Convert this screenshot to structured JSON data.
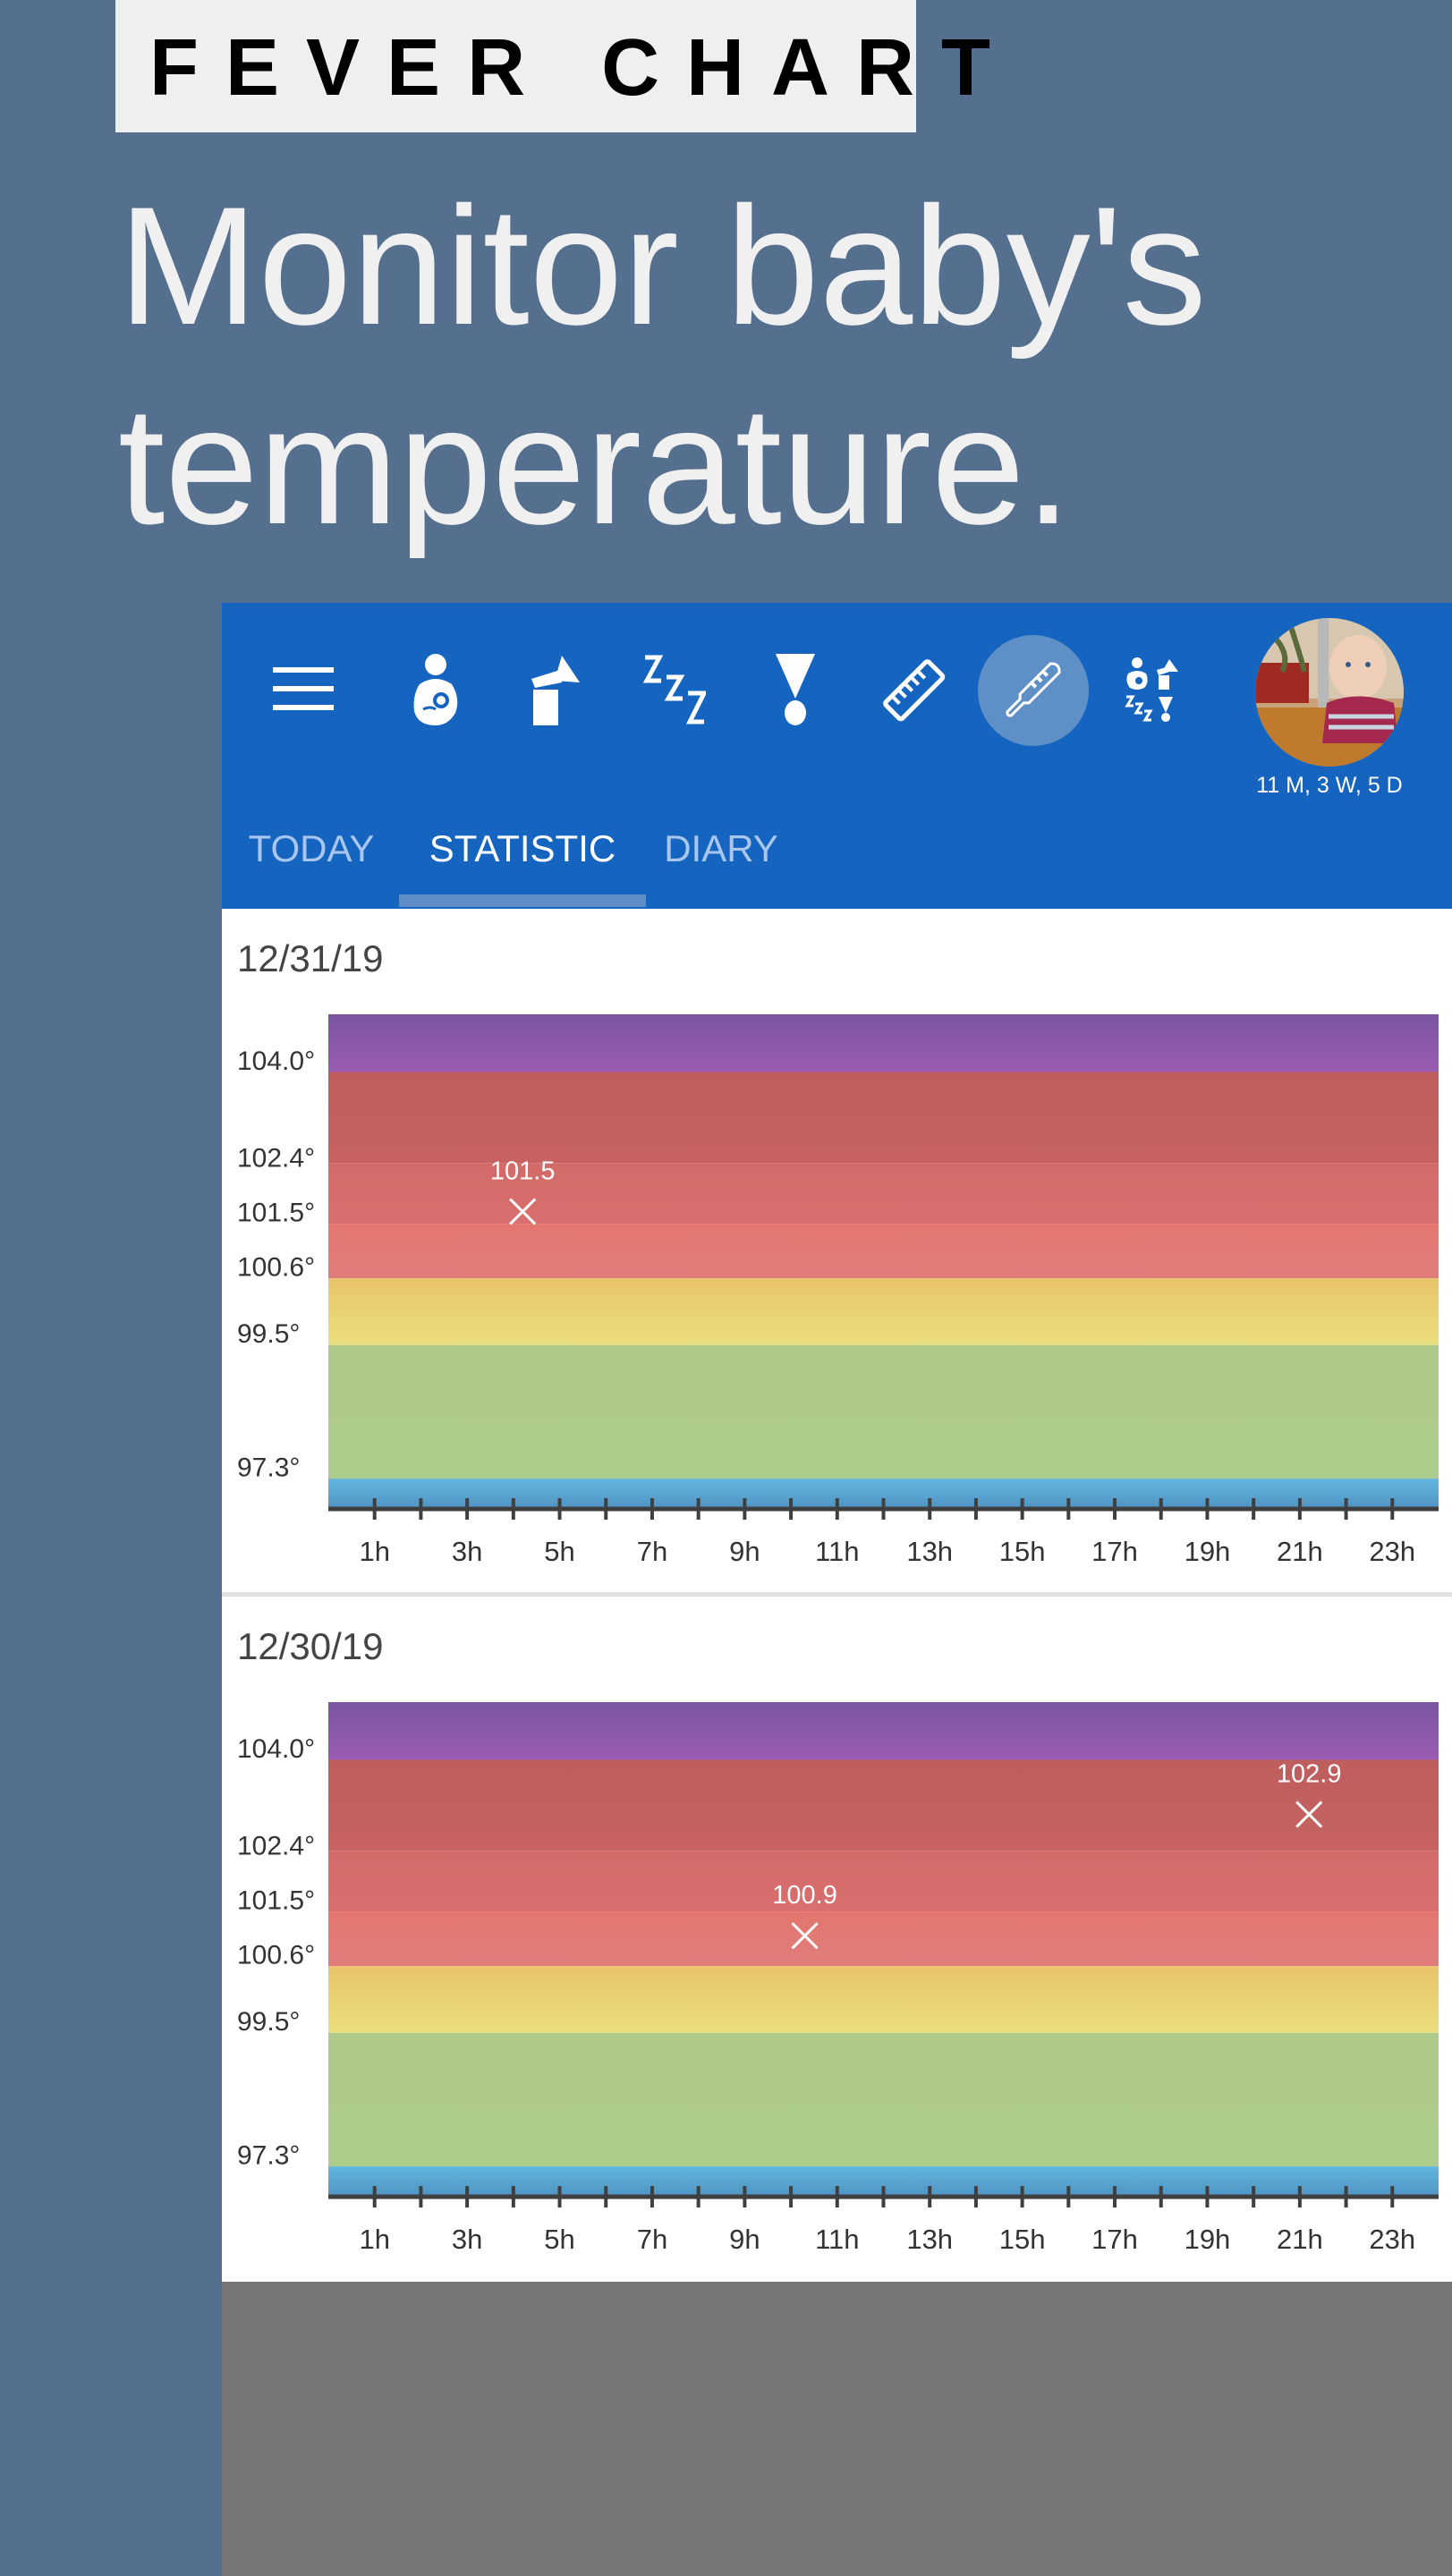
{
  "promo": {
    "badge": "FEVER CHART",
    "headline_line1": "Monitor baby's",
    "headline_line2": "temperature."
  },
  "appbar": {
    "icons": [
      {
        "name": "menu-icon",
        "label": "Menu"
      },
      {
        "name": "nursing-icon",
        "label": "Nursing"
      },
      {
        "name": "breast-pump-icon",
        "label": "Pumping"
      },
      {
        "name": "sleep-icon",
        "label": "Sleep"
      },
      {
        "name": "exclamation-icon",
        "label": "Events"
      },
      {
        "name": "ruler-icon",
        "label": "Growth"
      },
      {
        "name": "thermometer-icon",
        "label": "Temperature",
        "active": true
      },
      {
        "name": "multi-activity-icon",
        "label": "All activities"
      }
    ],
    "child_age": "11 M, 3 W, 5 D",
    "accent_color": "#1565c0"
  },
  "tabs": [
    {
      "label": "TODAY",
      "active": false
    },
    {
      "label": "STATISTIC",
      "active": true
    },
    {
      "label": "DIARY",
      "active": false
    }
  ],
  "days": [
    {
      "date": "12/31/19"
    },
    {
      "date": "12/30/19"
    }
  ],
  "chart_data": [
    {
      "type": "scatter",
      "title": "12/31/19",
      "xlabel": "",
      "ylabel": "",
      "x_unit": "h",
      "xlim": [
        0,
        24
      ],
      "ylim": [
        96.6,
        104.75
      ],
      "x_ticks": [
        1,
        2,
        3,
        4,
        5,
        6,
        7,
        8,
        9,
        10,
        11,
        12,
        13,
        14,
        15,
        16,
        17,
        18,
        19,
        20,
        21,
        22,
        23
      ],
      "x_tick_labels": [
        "1h",
        "3h",
        "5h",
        "7h",
        "9h",
        "11h",
        "13h",
        "15h",
        "17h",
        "19h",
        "21h",
        "23h"
      ],
      "x_tick_label_values": [
        1,
        3,
        5,
        7,
        9,
        11,
        13,
        15,
        17,
        19,
        21,
        23
      ],
      "y_tick_labels": [
        "104.0°",
        "102.4°",
        "101.5°",
        "100.6°",
        "99.5°",
        "97.3°"
      ],
      "y_tick_values": [
        104.0,
        102.4,
        101.5,
        100.6,
        99.5,
        97.3
      ],
      "zones": [
        {
          "name": "hyperpyrexia",
          "from": 103.8,
          "to": 104.75,
          "color_top": "#7a55a0",
          "color_bottom": "#9b5bb2"
        },
        {
          "name": "high-fever",
          "from": 102.3,
          "to": 103.8,
          "color_top": "#bf5e5e",
          "color_bottom": "#c66262"
        },
        {
          "name": "fever",
          "from": 101.3,
          "to": 102.3,
          "color_top": "#d16a68",
          "color_bottom": "#d96f6e"
        },
        {
          "name": "mild-fever",
          "from": 100.4,
          "to": 101.3,
          "color_top": "#e4766e",
          "color_bottom": "#e07d7c"
        },
        {
          "name": "elevated",
          "from": 99.3,
          "to": 100.4,
          "color_top": "#e9c46a",
          "color_bottom": "#ebdf80"
        },
        {
          "name": "normal",
          "from": 97.1,
          "to": 99.3,
          "color_top": "#adca8a",
          "color_bottom": "#adcb8a"
        },
        {
          "name": "low",
          "from": 96.6,
          "to": 97.1,
          "color_top": "#63b6e0",
          "color_bottom": "#4f93c2"
        }
      ],
      "points": [
        {
          "x": 4.2,
          "y": 101.5,
          "label": "101.5"
        }
      ],
      "legend": "none",
      "grid": false
    },
    {
      "type": "scatter",
      "title": "12/30/19",
      "xlabel": "",
      "ylabel": "",
      "x_unit": "h",
      "xlim": [
        0,
        24
      ],
      "ylim": [
        96.6,
        104.75
      ],
      "x_ticks": [
        1,
        2,
        3,
        4,
        5,
        6,
        7,
        8,
        9,
        10,
        11,
        12,
        13,
        14,
        15,
        16,
        17,
        18,
        19,
        20,
        21,
        22,
        23
      ],
      "x_tick_labels": [
        "1h",
        "3h",
        "5h",
        "7h",
        "9h",
        "11h",
        "13h",
        "15h",
        "17h",
        "19h",
        "21h",
        "23h"
      ],
      "x_tick_label_values": [
        1,
        3,
        5,
        7,
        9,
        11,
        13,
        15,
        17,
        19,
        21,
        23
      ],
      "y_tick_labels": [
        "104.0°",
        "102.4°",
        "101.5°",
        "100.6°",
        "99.5°",
        "97.3°"
      ],
      "y_tick_values": [
        104.0,
        102.4,
        101.5,
        100.6,
        99.5,
        97.3
      ],
      "zones": [
        {
          "name": "hyperpyrexia",
          "from": 103.8,
          "to": 104.75,
          "color_top": "#7a55a0",
          "color_bottom": "#9b5bb2"
        },
        {
          "name": "high-fever",
          "from": 102.3,
          "to": 103.8,
          "color_top": "#bf5e5e",
          "color_bottom": "#c66262"
        },
        {
          "name": "fever",
          "from": 101.3,
          "to": 102.3,
          "color_top": "#d16a68",
          "color_bottom": "#d96f6e"
        },
        {
          "name": "mild-fever",
          "from": 100.4,
          "to": 101.3,
          "color_top": "#e4766e",
          "color_bottom": "#e07d7c"
        },
        {
          "name": "elevated",
          "from": 99.3,
          "to": 100.4,
          "color_top": "#e9c46a",
          "color_bottom": "#ebdf80"
        },
        {
          "name": "normal",
          "from": 97.1,
          "to": 99.3,
          "color_top": "#adca8a",
          "color_bottom": "#adcb8a"
        },
        {
          "name": "low",
          "from": 96.6,
          "to": 97.1,
          "color_top": "#63b6e0",
          "color_bottom": "#4f93c2"
        }
      ],
      "points": [
        {
          "x": 10.3,
          "y": 100.9,
          "label": "100.9"
        },
        {
          "x": 21.2,
          "y": 102.9,
          "label": "102.9"
        }
      ],
      "legend": "none",
      "grid": false
    }
  ]
}
